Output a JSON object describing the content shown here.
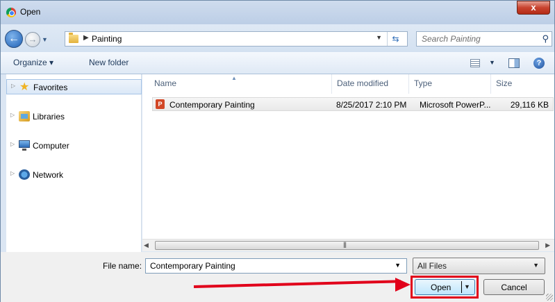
{
  "window": {
    "title": "Open",
    "close_glyph": "x"
  },
  "address": {
    "crumb": "Painting",
    "search_placeholder": "Search Painting"
  },
  "toolbar": {
    "organize_label": "Organize ▾",
    "new_folder_label": "New folder"
  },
  "nav": {
    "items": [
      {
        "label": "Favorites",
        "icon": "star-icon",
        "selected": true
      },
      {
        "label": "Libraries",
        "icon": "libraries-icon",
        "selected": false
      },
      {
        "label": "Computer",
        "icon": "computer-icon",
        "selected": false
      },
      {
        "label": "Network",
        "icon": "network-icon",
        "selected": false
      }
    ]
  },
  "columns": {
    "name": "Name",
    "date": "Date modified",
    "type": "Type",
    "size": "Size"
  },
  "files": [
    {
      "name": "Contemporary Painting",
      "date": "8/25/2017 2:10 PM",
      "type": "Microsoft PowerP...",
      "size": "29,116 KB",
      "icon": "powerpoint-file-icon"
    }
  ],
  "bottom": {
    "file_name_label": "File name:",
    "file_name_value": "Contemporary Painting",
    "file_type": "All Files",
    "open_label": "Open",
    "cancel_label": "Cancel"
  },
  "colors": {
    "annotation": "#e1001a",
    "accent": "#3c7fb1"
  }
}
